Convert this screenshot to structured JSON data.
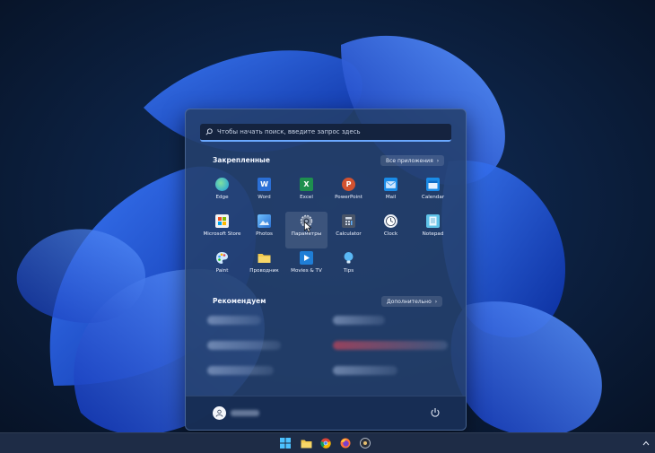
{
  "search": {
    "placeholder": "Чтобы начать поиск, введите запрос здесь",
    "icon": "search-icon"
  },
  "pinned": {
    "title": "Закрепленные",
    "all_apps_label": "Все приложения",
    "apps": [
      {
        "label": "Edge",
        "icon": "edge-icon",
        "color": "#2bb0e8"
      },
      {
        "label": "Word",
        "icon": "word-icon",
        "color": "#2b6fd6"
      },
      {
        "label": "Excel",
        "icon": "excel-icon",
        "color": "#1e8f4e"
      },
      {
        "label": "PowerPoint",
        "icon": "powerpoint-icon",
        "color": "#d35230"
      },
      {
        "label": "Mail",
        "icon": "mail-icon",
        "color": "#1a8ce8"
      },
      {
        "label": "Calendar",
        "icon": "calendar-icon",
        "color": "#1a8ce8"
      },
      {
        "label": "Microsoft Store",
        "icon": "store-icon",
        "color": "#f3f3f3"
      },
      {
        "label": "Photos",
        "icon": "photos-icon",
        "color": "#4aa8f0"
      },
      {
        "label": "Параметры",
        "icon": "gear-icon",
        "color": "#8a98ad"
      },
      {
        "label": "Calculator",
        "icon": "calculator-icon",
        "color": "#5a6578"
      },
      {
        "label": "Clock",
        "icon": "clock-icon",
        "color": "#e9eef6"
      },
      {
        "label": "Notepad",
        "icon": "notepad-icon",
        "color": "#5fc3e8"
      },
      {
        "label": "Paint",
        "icon": "paint-icon",
        "color": "#7ec9f0"
      },
      {
        "label": "Проводник",
        "icon": "folder-icon",
        "color": "#f2c94c"
      },
      {
        "label": "Movies & TV",
        "icon": "movies-icon",
        "color": "#1f7ed6"
      },
      {
        "label": "Tips",
        "icon": "tips-icon",
        "color": "#4ab0f0"
      }
    ]
  },
  "recommended": {
    "title": "Рекомендуем",
    "more_label": "Дополнительно"
  },
  "colors": {
    "accent": "#6aa8ff",
    "menu_bg": "#24406c",
    "taskbar_bg": "#1e2c46"
  }
}
